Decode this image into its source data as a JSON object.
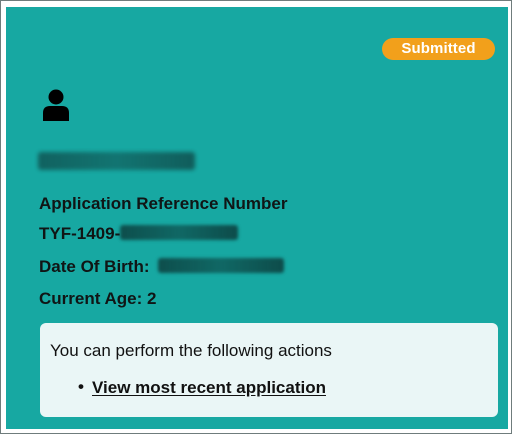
{
  "badge": {
    "label": "Submitted",
    "color": "#f2a01b"
  },
  "card": {
    "background_color": "#17a8a2"
  },
  "user": {
    "icon": "user-icon",
    "name_obscured": true
  },
  "details": {
    "reference_label": "Application Reference Number",
    "reference_prefix": "TYF-1409-",
    "reference_obscured": true,
    "dob_label": "Date Of Birth:",
    "dob_obscured": true,
    "age_label": "Current Age:",
    "age_value": "2"
  },
  "actions": {
    "intro": "You can perform the following actions",
    "items": [
      {
        "label": "View most recent application"
      }
    ]
  }
}
